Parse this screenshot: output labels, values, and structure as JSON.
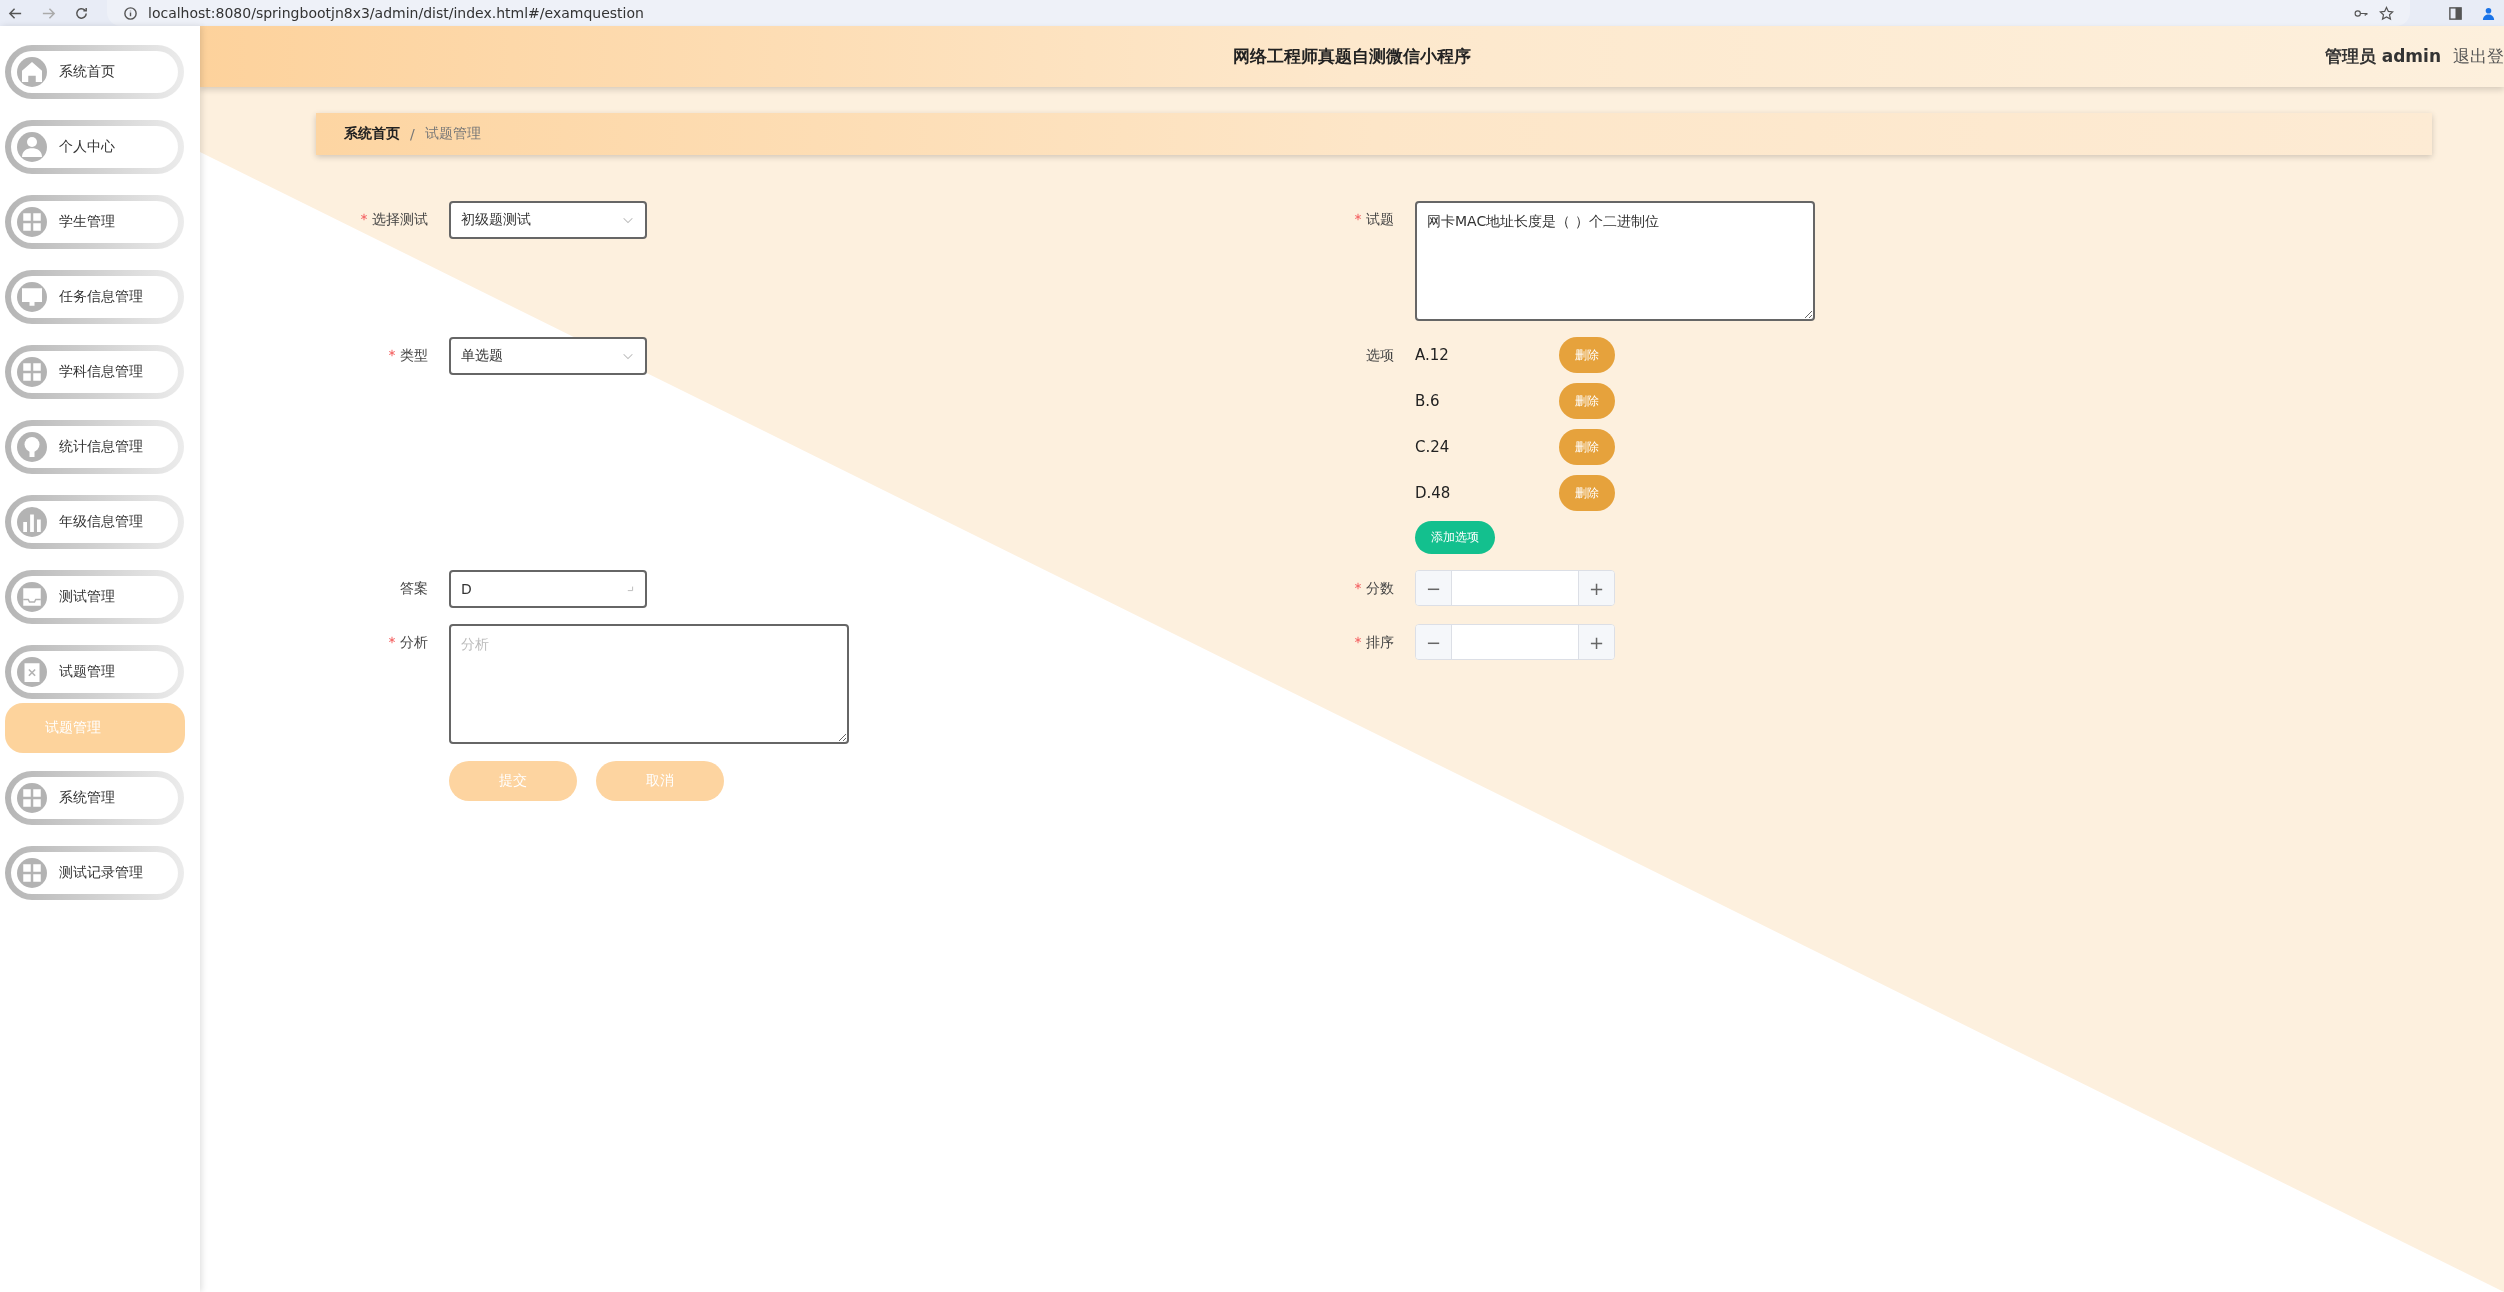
{
  "browser": {
    "url": "localhost:8080/springbootjn8x3/admin/dist/index.html#/examquestion"
  },
  "header": {
    "title": "网络工程师真题自测微信小程序",
    "user": "管理员 admin",
    "logout": "退出登"
  },
  "sidebar": {
    "items": [
      {
        "label": "系统首页"
      },
      {
        "label": "个人中心"
      },
      {
        "label": "学生管理"
      },
      {
        "label": "任务信息管理"
      },
      {
        "label": "学科信息管理"
      },
      {
        "label": "统计信息管理"
      },
      {
        "label": "年级信息管理"
      },
      {
        "label": "测试管理"
      },
      {
        "label": "试题管理",
        "children": [
          {
            "label": "试题管理",
            "selected": true
          }
        ]
      },
      {
        "label": "系统管理"
      },
      {
        "label": "测试记录管理"
      }
    ]
  },
  "breadcrumb": {
    "separator": "/",
    "items": [
      {
        "label": "系统首页",
        "current": false
      },
      {
        "label": "试题管理",
        "current": true
      }
    ]
  },
  "form": {
    "fields": [
      {
        "kind": "select",
        "label": "选择测试",
        "required": true,
        "value": "初级题测试"
      },
      {
        "kind": "textarea",
        "label": "试题",
        "required": true,
        "value": "网卡MAC地址长度是（ ）个二进制位"
      },
      {
        "kind": "select",
        "label": "类型",
        "required": true,
        "value": "单选题"
      },
      {
        "kind": "options",
        "label": "选项",
        "required": false,
        "options": [
          {
            "text": "A.12",
            "action": "删除"
          },
          {
            "text": "B.6",
            "action": "删除"
          },
          {
            "text": "C.24",
            "action": "删除"
          },
          {
            "text": "D.48",
            "action": "删除"
          }
        ],
        "add_button": "添加选项"
      },
      {
        "kind": "input",
        "label": "答案",
        "required": false,
        "value": "D"
      },
      {
        "kind": "number",
        "label": "分数",
        "required": true,
        "minus": "−",
        "plus": "+"
      },
      {
        "kind": "textarea",
        "label": "分析",
        "required": true,
        "placeholder": "分析"
      },
      {
        "kind": "number",
        "label": "排序",
        "required": true,
        "minus": "−",
        "plus": "+"
      }
    ],
    "buttons": [
      {
        "label": "提交"
      },
      {
        "label": "取消"
      }
    ]
  }
}
